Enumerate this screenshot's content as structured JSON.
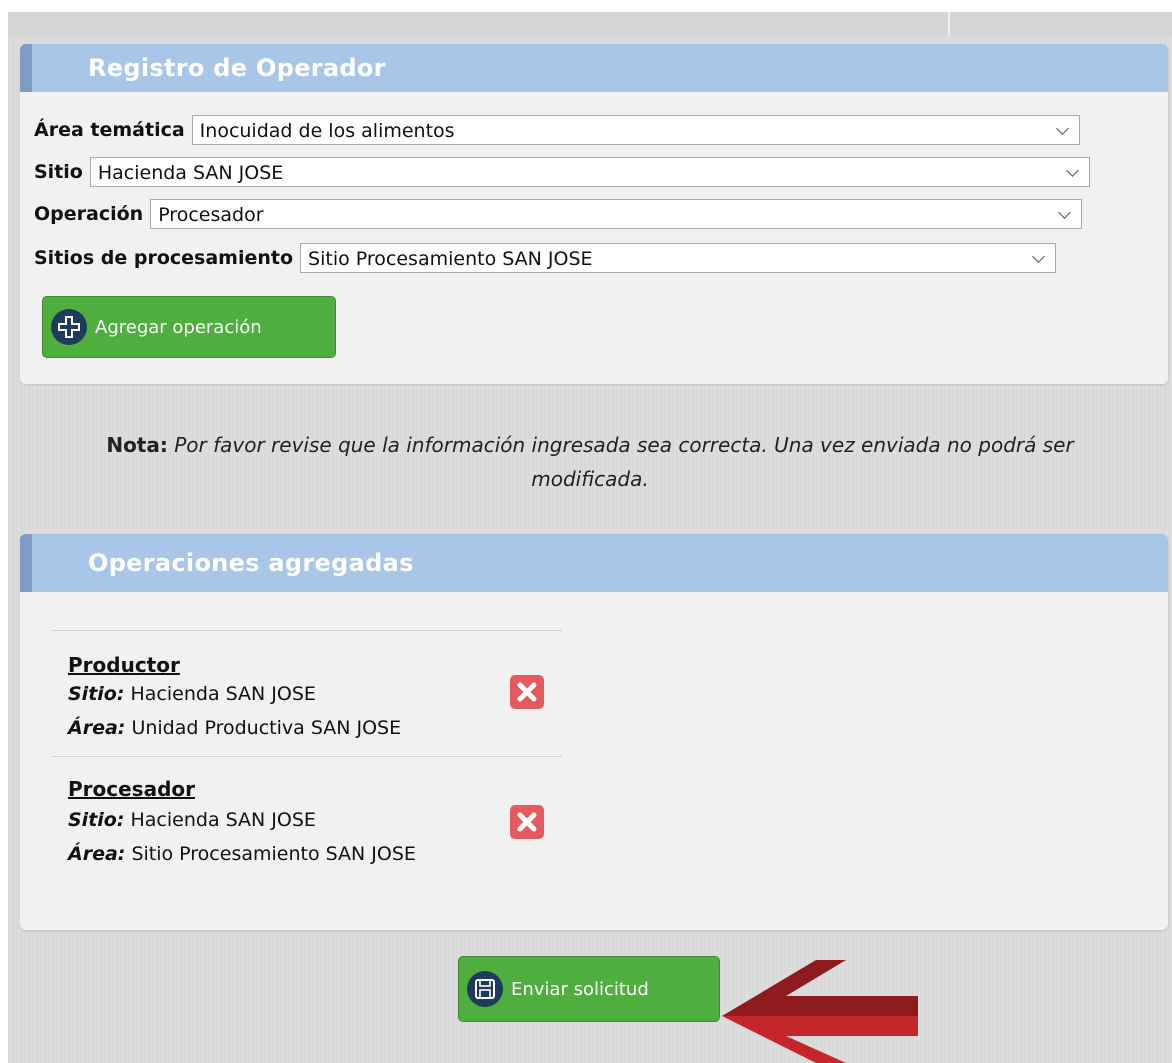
{
  "registro": {
    "title": "Registro de Operador",
    "fields": [
      {
        "label": "Área temática",
        "value": "Inocuidad de los alimentos"
      },
      {
        "label": "Sitio",
        "value": "Hacienda SAN JOSE"
      },
      {
        "label": "Operación",
        "value": "Procesador"
      },
      {
        "label": "Sitios de procesamiento",
        "value": "Sitio Procesamiento SAN JOSE"
      }
    ],
    "add_button_label": "Agregar operación"
  },
  "note": {
    "prefix": "Nota:",
    "text_line1": "Por favor revise que la información ingresada sea correcta. Una vez enviada no podrá ser",
    "text_line2": "modificada."
  },
  "operaciones": {
    "title": "Operaciones agregadas",
    "items": [
      {
        "name": "Productor",
        "sitio_label": "Sitio:",
        "sitio": "Hacienda SAN JOSE",
        "area_label": "Área:",
        "area": "Unidad Productiva SAN JOSE"
      },
      {
        "name": "Procesador",
        "sitio_label": "Sitio:",
        "sitio": "Hacienda SAN JOSE",
        "area_label": "Área:",
        "area": "Sitio Procesamiento SAN JOSE"
      }
    ]
  },
  "submit_button_label": "Enviar solicitud",
  "colors": {
    "panel_header": "#a8c6e8",
    "green_button": "#4eae3e",
    "delete_button": "#e35b5f",
    "arrow": "#b32227"
  }
}
